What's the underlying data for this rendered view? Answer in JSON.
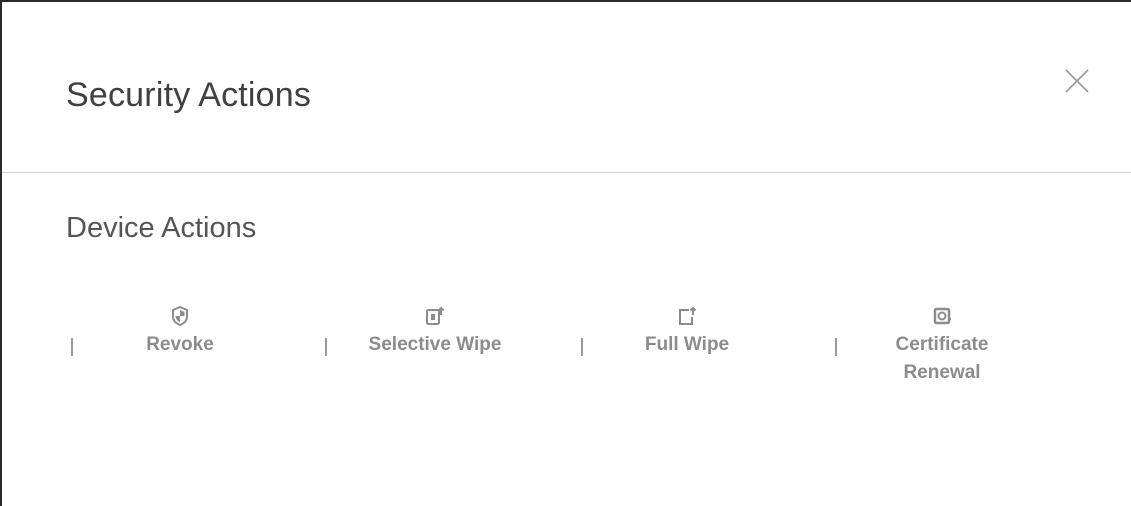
{
  "dialog": {
    "title": "Security Actions",
    "close_icon": "close-icon"
  },
  "section": {
    "title": "Device Actions"
  },
  "actions": [
    {
      "label": "Revoke",
      "icon": "shield-icon"
    },
    {
      "label": "Selective Wipe",
      "icon": "selective-wipe-icon"
    },
    {
      "label": "Full Wipe",
      "icon": "full-wipe-icon"
    },
    {
      "label_line1": "Certificate",
      "label_line2": "Renewal",
      "icon": "certificate-icon"
    }
  ],
  "colors": {
    "title": "#404040",
    "section_title": "#555555",
    "action_label": "#8c8c8c",
    "icon": "#8c8c8c",
    "divider_line": "#d4d4d4"
  }
}
